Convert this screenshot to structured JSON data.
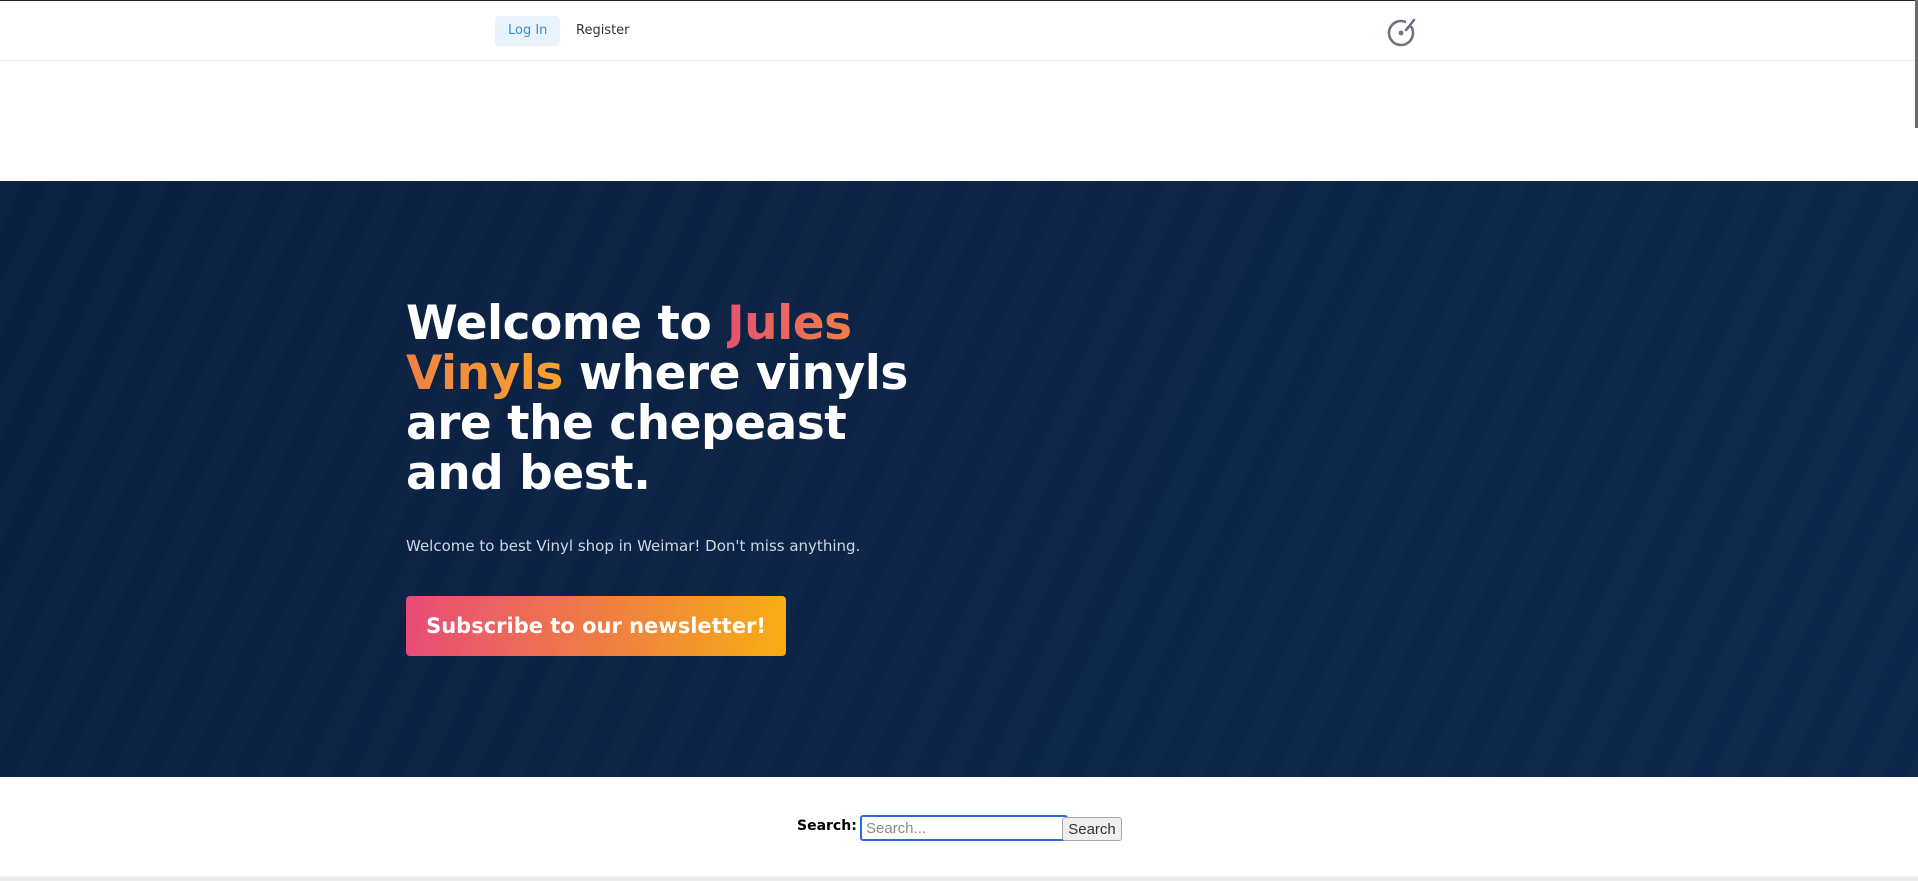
{
  "nav": {
    "login_label": "Log In",
    "register_label": "Register",
    "logo_icon": "vinyl-record-icon"
  },
  "hero": {
    "title_part1": "Welcome to ",
    "title_highlight": "Jules Vinyls",
    "title_part2": " where vinyls are the chepeast and best.",
    "subtitle": "Welcome to best Vinyl shop in Weimar! Don't miss anything.",
    "cta_label": "Subscribe to our newsletter!",
    "background_color": "#0c2447",
    "accent_gradient": [
      "#e84b76",
      "#f7ad10"
    ]
  },
  "search": {
    "label": "Search:",
    "placeholder": "Search...",
    "value": "",
    "button_label": "Search"
  }
}
